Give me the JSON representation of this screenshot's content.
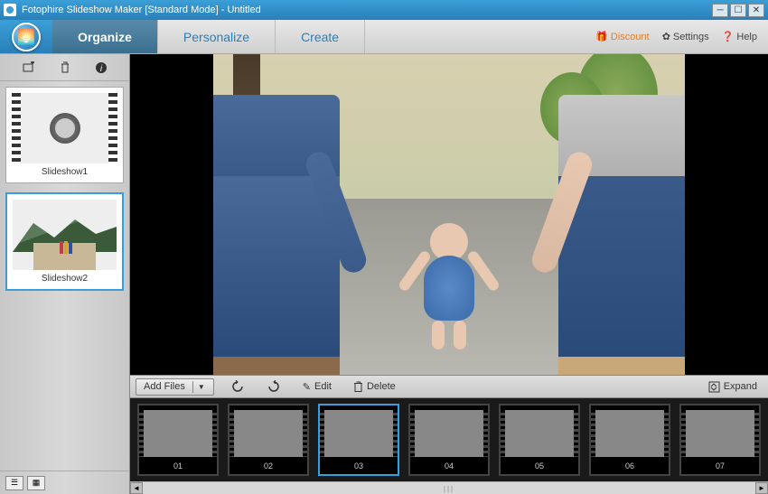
{
  "window": {
    "title": "Fotophire Slideshow Maker [Standard Mode] - Untitled"
  },
  "tabs": {
    "organize": "Organize",
    "personalize": "Personalize",
    "create": "Create"
  },
  "topTools": {
    "discount": "Discount",
    "settings": "Settings",
    "help": "Help"
  },
  "slideshows": [
    {
      "label": "Slideshow1",
      "type": "film"
    },
    {
      "label": "Slideshow2",
      "type": "photo"
    }
  ],
  "actions": {
    "addFiles": "Add Files",
    "edit": "Edit",
    "delete": "Delete",
    "expand": "Expand"
  },
  "frames": [
    {
      "num": "01"
    },
    {
      "num": "02"
    },
    {
      "num": "03"
    },
    {
      "num": "04"
    },
    {
      "num": "05"
    },
    {
      "num": "06"
    },
    {
      "num": "07"
    }
  ],
  "selectedFrameIndex": 2,
  "selectedSlideshowIndex": 1
}
